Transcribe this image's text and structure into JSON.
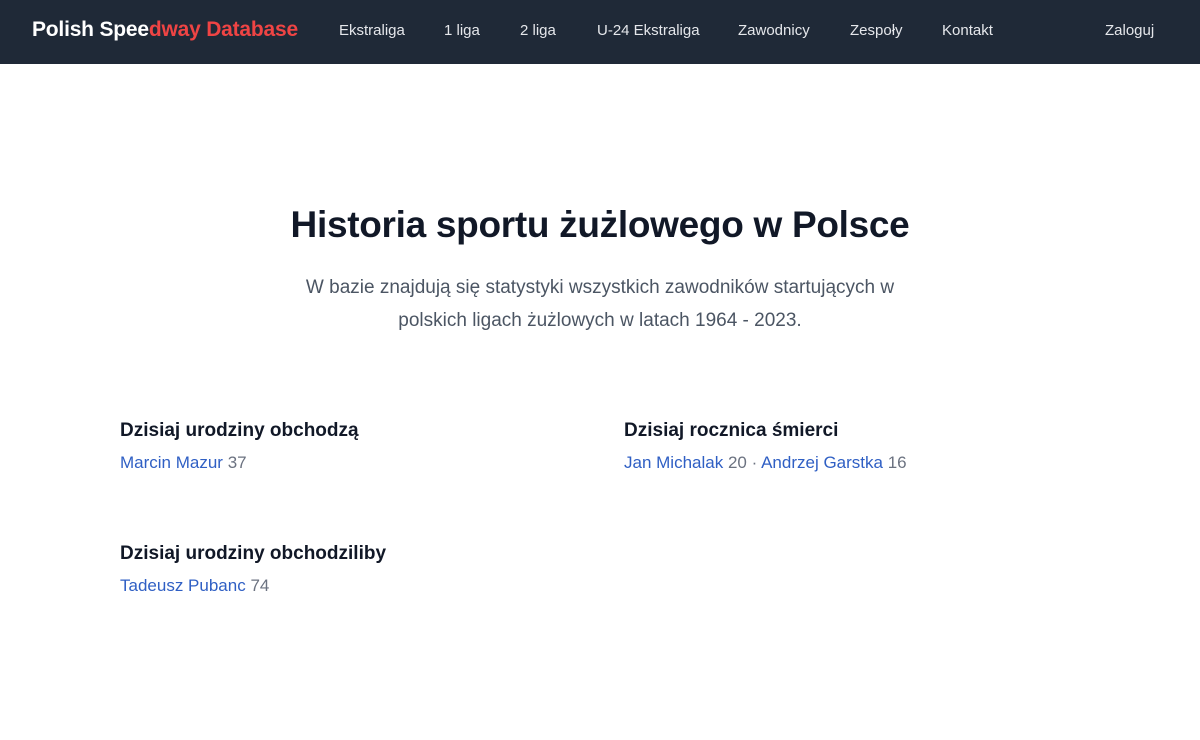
{
  "header": {
    "logo_part1": "Polish Spee",
    "logo_part2": "dway Database",
    "nav": [
      {
        "label": "Ekstraliga"
      },
      {
        "label": "1 liga"
      },
      {
        "label": "2 liga"
      },
      {
        "label": "U-24 Ekstraliga"
      },
      {
        "label": "Zawodnicy"
      },
      {
        "label": "Zespoły"
      },
      {
        "label": "Kontakt"
      }
    ],
    "login_label": "Zaloguj"
  },
  "hero": {
    "title": "Historia sportu żużlowego w Polsce",
    "subtitle": "W bazie znajdują się statystyki wszystkich zawodników startujących w polskich ligach żużlowych w latach 1964 - 2023."
  },
  "birthdays": {
    "heading": "Dzisiaj urodziny obchodzą",
    "people": [
      {
        "name": "Marcin Mazur",
        "age": "37"
      }
    ]
  },
  "death_anniversaries": {
    "heading": "Dzisiaj rocznica śmierci",
    "separator": "·",
    "people": [
      {
        "name": "Jan Michalak",
        "years": "20"
      },
      {
        "name": "Andrzej Garstka",
        "years": "16"
      }
    ]
  },
  "would_be_birthdays": {
    "heading": "Dzisiaj urodziny obchodziliby",
    "people": [
      {
        "name": "Tadeusz Pubanc",
        "age": "74"
      }
    ]
  },
  "colors": {
    "navbar_bg": "#1f2937",
    "logo_accent": "#ef4444",
    "link": "#2f5fc4"
  }
}
